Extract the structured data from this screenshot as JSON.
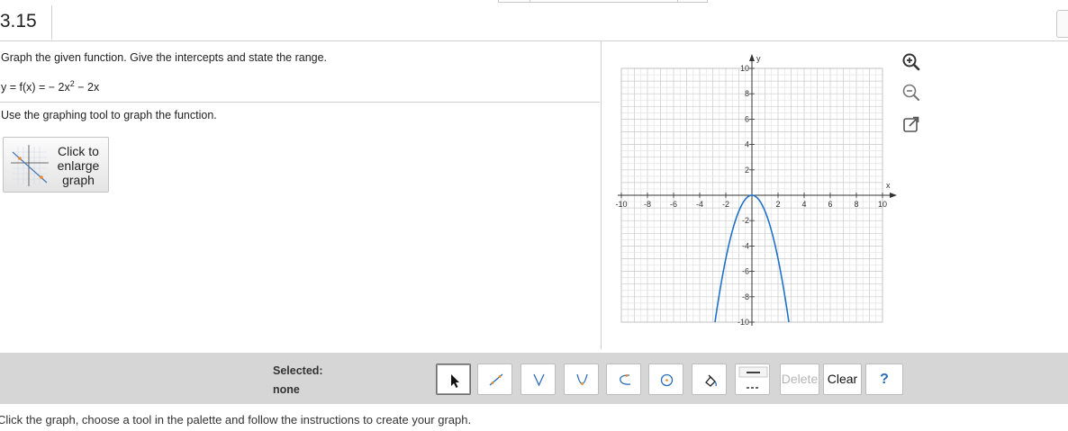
{
  "header": {
    "question_number": ".3.15"
  },
  "question": {
    "instruction": "Graph the given function. Give the intercepts and state the range.",
    "function_prefix": "y = f(x) = − 2x",
    "function_exponent": "2",
    "function_suffix": " − 2x",
    "tool_instruction": "Use the graphing tool to graph the function."
  },
  "enlarge_button": {
    "line1": "Click to",
    "line2": "enlarge",
    "line3": "graph"
  },
  "graph": {
    "x_axis_label": "x",
    "y_axis_label": "y",
    "x_range": [
      -10,
      10
    ],
    "y_range": [
      -10,
      10
    ],
    "x_tick_labels": [
      "-10",
      "-8",
      "-6",
      "-4",
      "-2",
      "2",
      "4",
      "6",
      "8",
      "10"
    ],
    "y_tick_labels": [
      "10",
      "8",
      "6",
      "4",
      "2",
      "-2",
      "-4",
      "-6",
      "-8",
      "-10"
    ],
    "curve_color": "#1f72c9",
    "curve": {
      "type": "parabola",
      "vertex": [
        0,
        0
      ],
      "a": -1.25
    }
  },
  "icons": {
    "zoom_in": "zoom-in-icon",
    "zoom_out": "zoom-out-icon",
    "popout": "popout-icon"
  },
  "toolbar": {
    "selected_label": "Selected:",
    "selected_value": "none",
    "tools": [
      "pointer",
      "segment",
      "absolute-value",
      "parabola",
      "exponential",
      "circle",
      "fill"
    ],
    "delete_label": "Delete",
    "clear_label": "Clear",
    "help_label": "?"
  },
  "footer": {
    "hint": "Click the graph, choose a tool in the palette and follow the instructions to create your graph."
  }
}
